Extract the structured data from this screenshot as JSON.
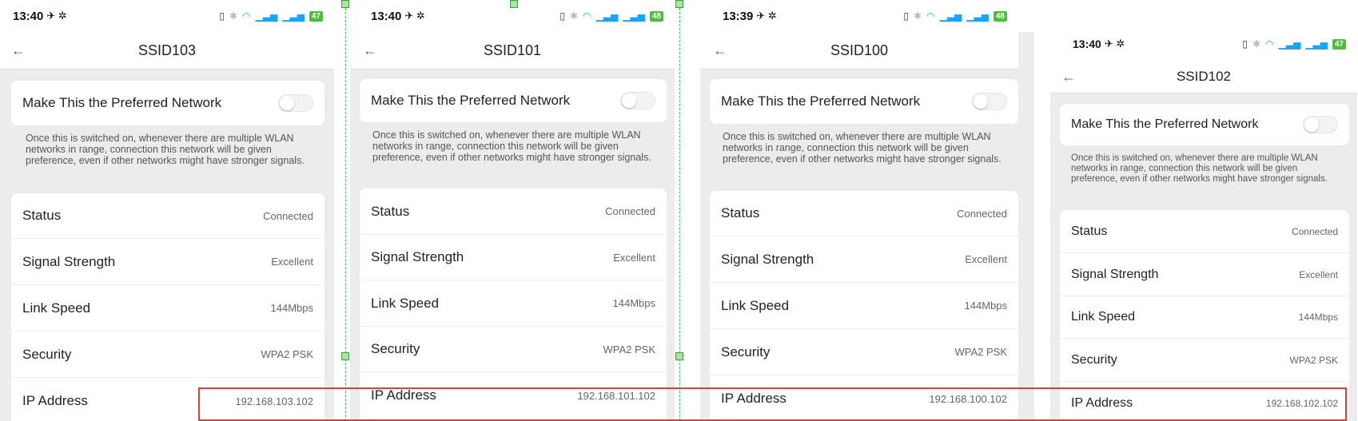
{
  "pref_label": "Make This the Preferred Network",
  "pref_description": "Once this is switched on, whenever there are multiple WLAN networks in range, connection this network will be given preference, even if other networks might have stronger signals.",
  "row_labels": {
    "status": "Status",
    "signal": "Signal Strength",
    "link_speed": "Link Speed",
    "security": "Security",
    "ip": "IP Address"
  },
  "icons": {
    "back": "back-arrow-icon",
    "wifi": "wifi-icon",
    "bluetooth": "bluetooth-icon",
    "vibrate": "vibrate-icon",
    "signal": "cell-signal-icon",
    "battery": "battery-icon"
  },
  "colors": {
    "highlight": "#e63b3b",
    "battery": "#4bbf3a",
    "wifi": "#1aa3ff",
    "guide": "#3fc060"
  },
  "screens": [
    {
      "time": "13:40",
      "battery": "47",
      "title": "SSID103",
      "status": "Connected",
      "signal": "Excellent",
      "link_speed": "144Mbps",
      "security": "WPA2 PSK",
      "ip": "192.168.103.102"
    },
    {
      "time": "13:40",
      "battery": "48",
      "title": "SSID101",
      "status": "Connected",
      "signal": "Excellent",
      "link_speed": "144Mbps",
      "security": "WPA2 PSK",
      "ip": "192.168.101.102"
    },
    {
      "time": "13:39",
      "battery": "48",
      "title": "SSID100",
      "status": "Connected",
      "signal": "Excellent",
      "link_speed": "144Mbps",
      "security": "WPA2 PSK",
      "ip": "192.168.100.102"
    },
    {
      "time": "13:40",
      "battery": "47",
      "title": "SSID102",
      "status": "Connected",
      "signal": "Excellent",
      "link_speed": "144Mbps",
      "security": "WPA2 PSK",
      "ip": "192.168.102.102"
    }
  ]
}
